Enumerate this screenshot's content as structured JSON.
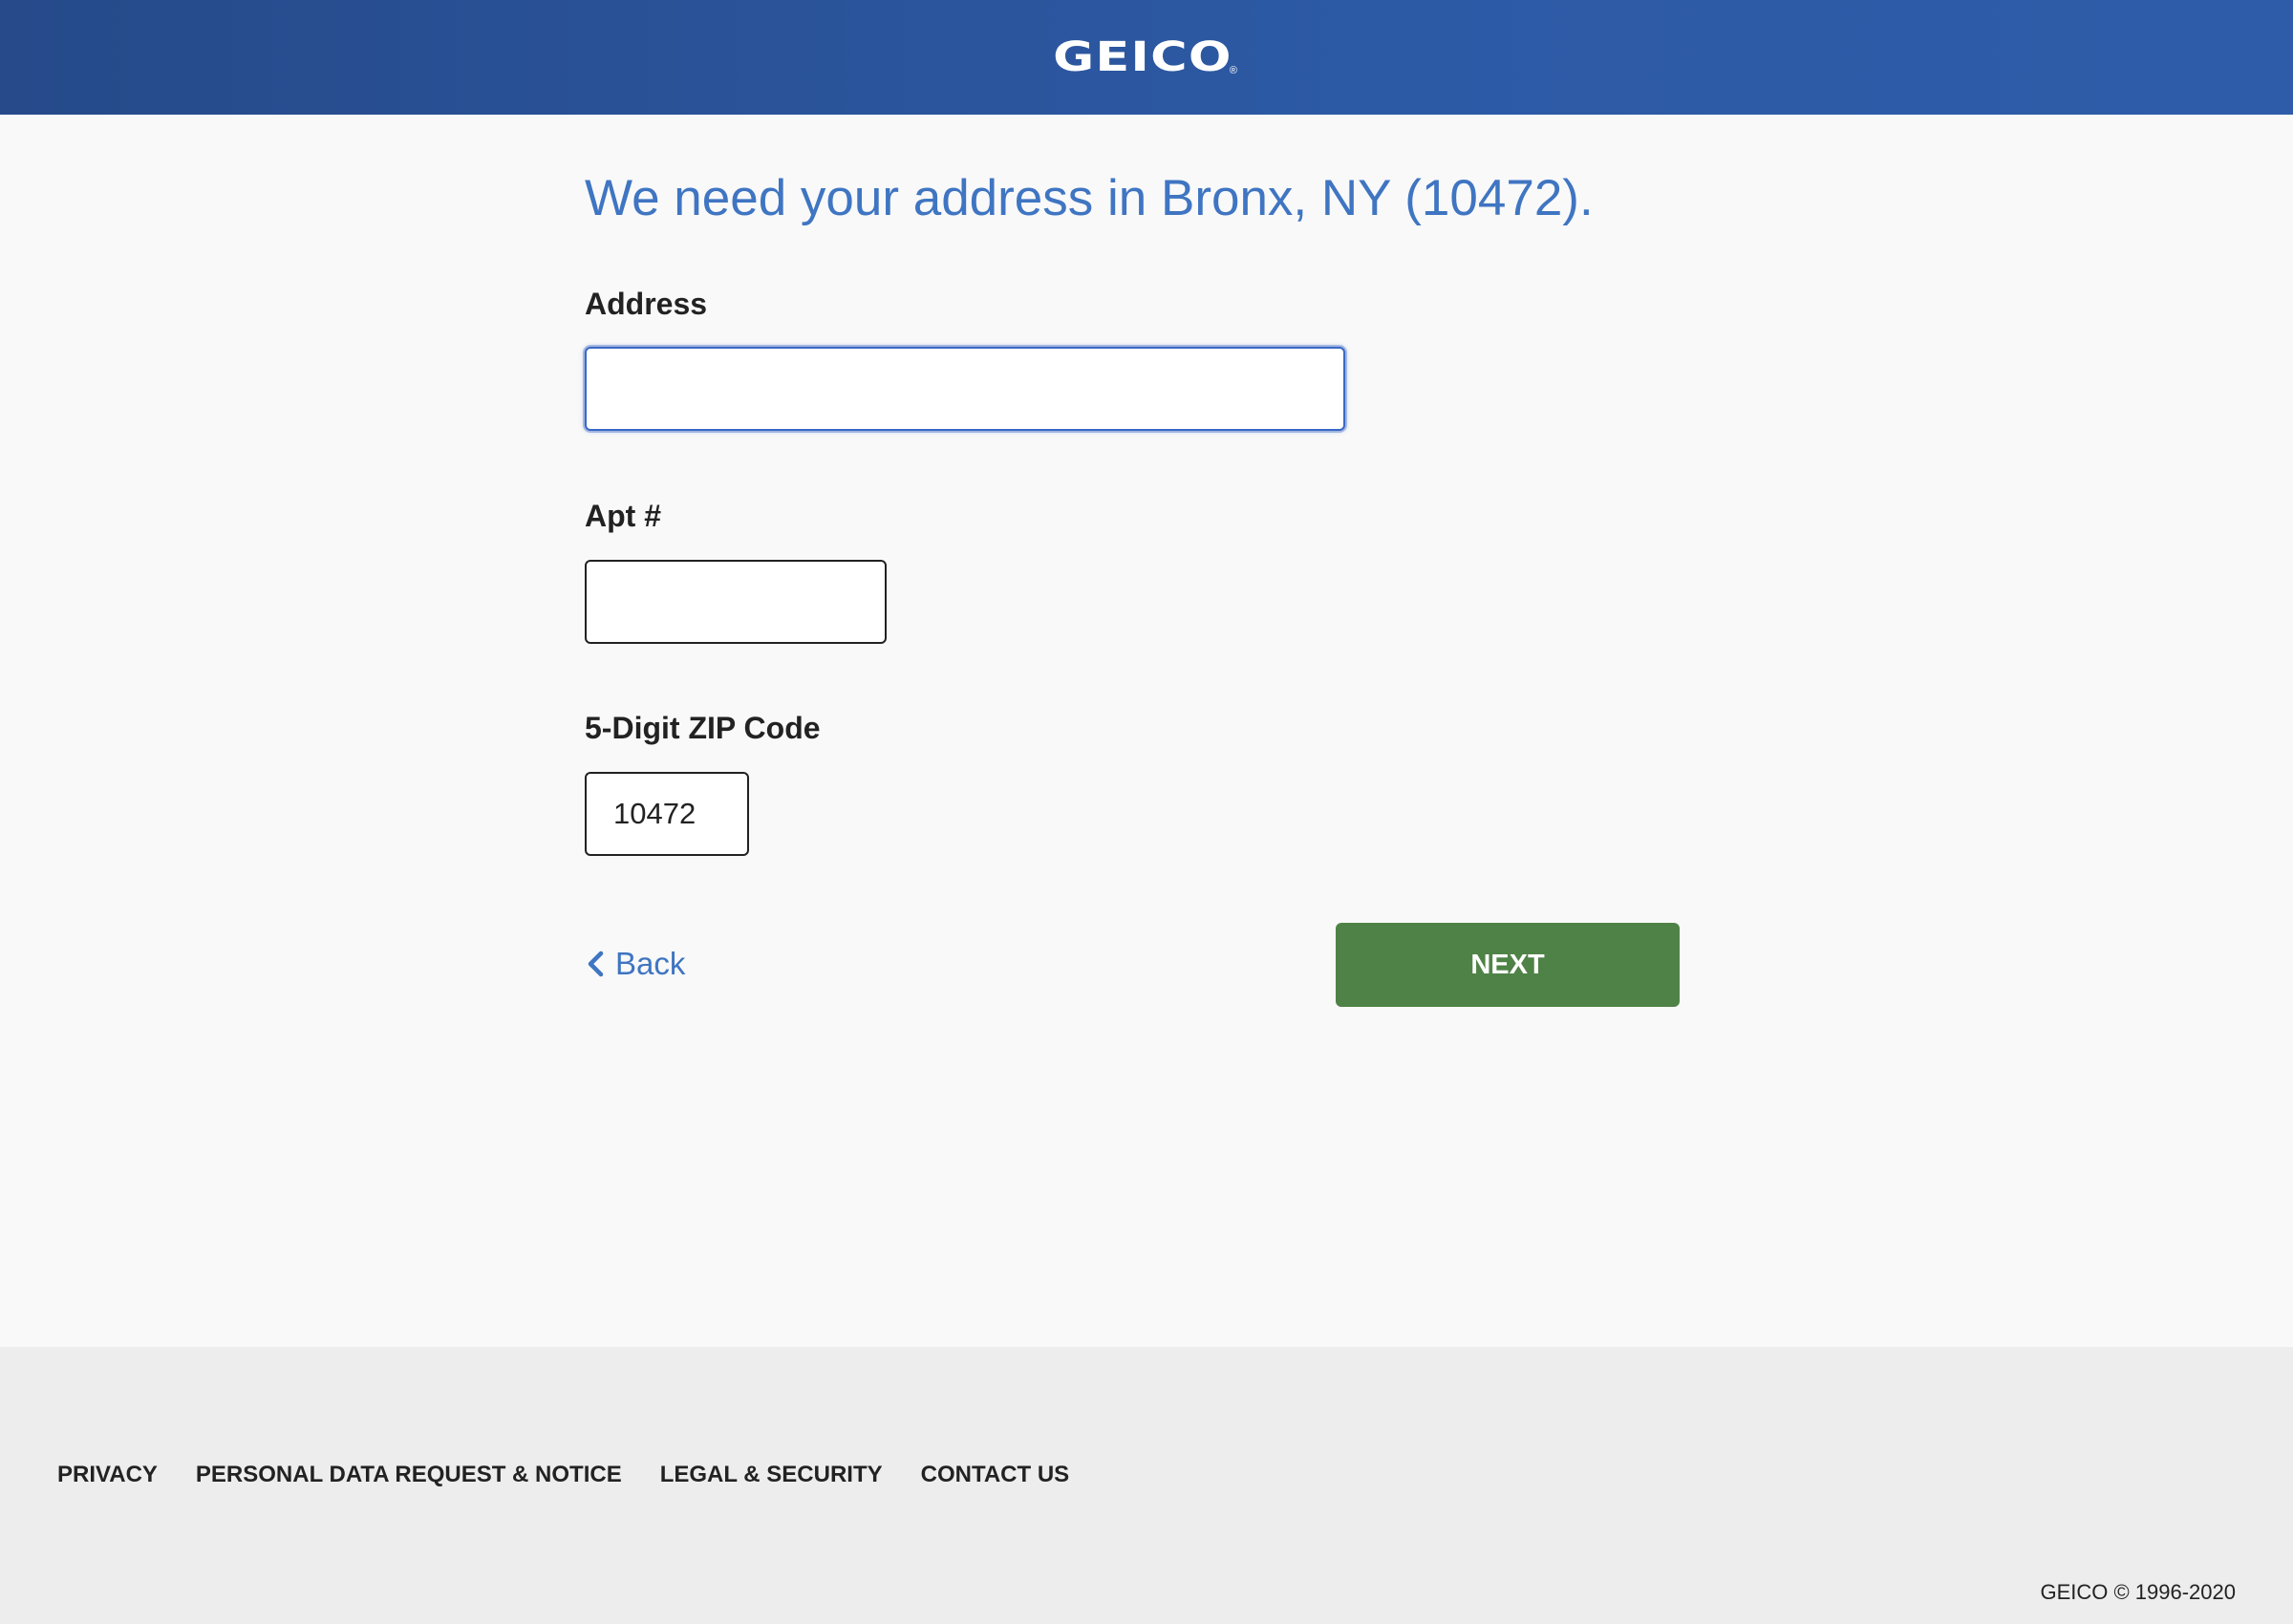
{
  "header": {
    "logo_text": "GEICO",
    "logo_mark": "®",
    "background_color": "#2b54a0"
  },
  "main": {
    "heading": "We need your address in Bronx, NY (10472).",
    "address": {
      "label": "Address",
      "value": ""
    },
    "apt": {
      "label": "Apt #",
      "value": ""
    },
    "zip": {
      "label": "5-Digit ZIP Code",
      "value": "10472"
    },
    "back_label": "Back",
    "back_icon": "chevron-left-icon",
    "next_label": "NEXT",
    "next_color": "#4f8246",
    "accent_color": "#3f75c2"
  },
  "footer": {
    "links": [
      {
        "label": "PRIVACY"
      },
      {
        "label": "PERSONAL DATA REQUEST & NOTICE"
      },
      {
        "label": "LEGAL & SECURITY"
      },
      {
        "label": "CONTACT US"
      }
    ],
    "copyright": "GEICO © 1996-2020"
  }
}
